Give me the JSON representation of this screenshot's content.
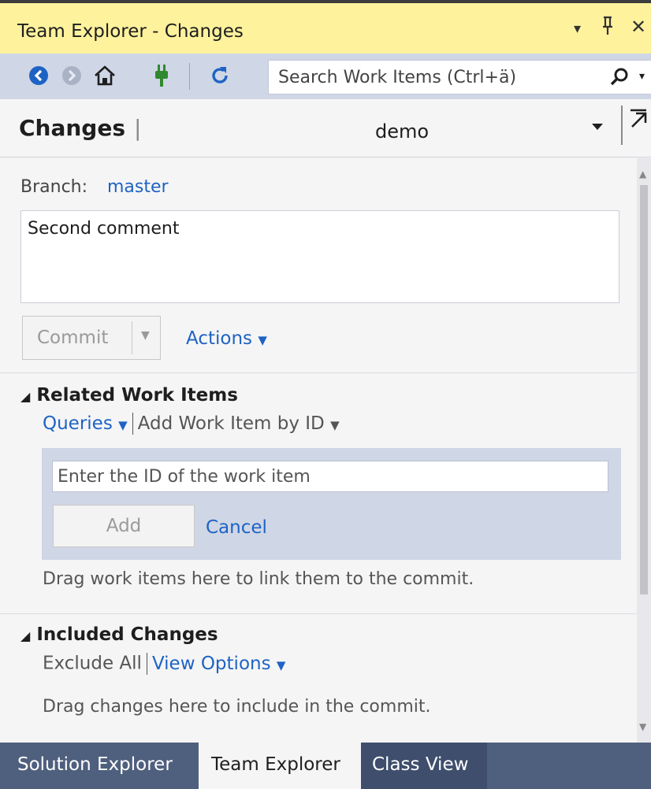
{
  "window": {
    "title": "Team Explorer - Changes",
    "controls": {
      "dropdown": "▾",
      "pin": "🖈",
      "close": "✕"
    }
  },
  "toolbar": {
    "search_placeholder": "Search Work Items (Ctrl+ä)",
    "icons": [
      "back-icon",
      "forward-icon",
      "home-icon",
      "connect-icon",
      "refresh-icon",
      "search-icon"
    ]
  },
  "header": {
    "title": "Changes",
    "separator": "|",
    "repo": "demo"
  },
  "changes": {
    "branch_label": "Branch:",
    "branch_value": "master",
    "comment": "Second comment",
    "commit_label": "Commit",
    "actions_label": "Actions"
  },
  "related": {
    "title": "Related Work Items",
    "queries_label": "Queries",
    "add_by_id_label": "Add Work Item by ID",
    "id_placeholder": "Enter the ID of the work item",
    "add_label": "Add",
    "cancel_label": "Cancel",
    "drag_hint": "Drag work items here to link them to the commit."
  },
  "included": {
    "title": "Included Changes",
    "exclude_all_label": "Exclude All",
    "view_options_label": "View Options",
    "drag_hint": "Drag changes here to include in the commit."
  },
  "tabs": [
    {
      "label": "Solution Explorer",
      "active": false
    },
    {
      "label": "Team Explorer",
      "active": true
    },
    {
      "label": "Class View",
      "active": false
    }
  ],
  "colors": {
    "title_bar": "#fff29d",
    "toolbar": "#cfd6e5",
    "link": "#1e63c4",
    "tab_strip": "#4f5f7e"
  }
}
